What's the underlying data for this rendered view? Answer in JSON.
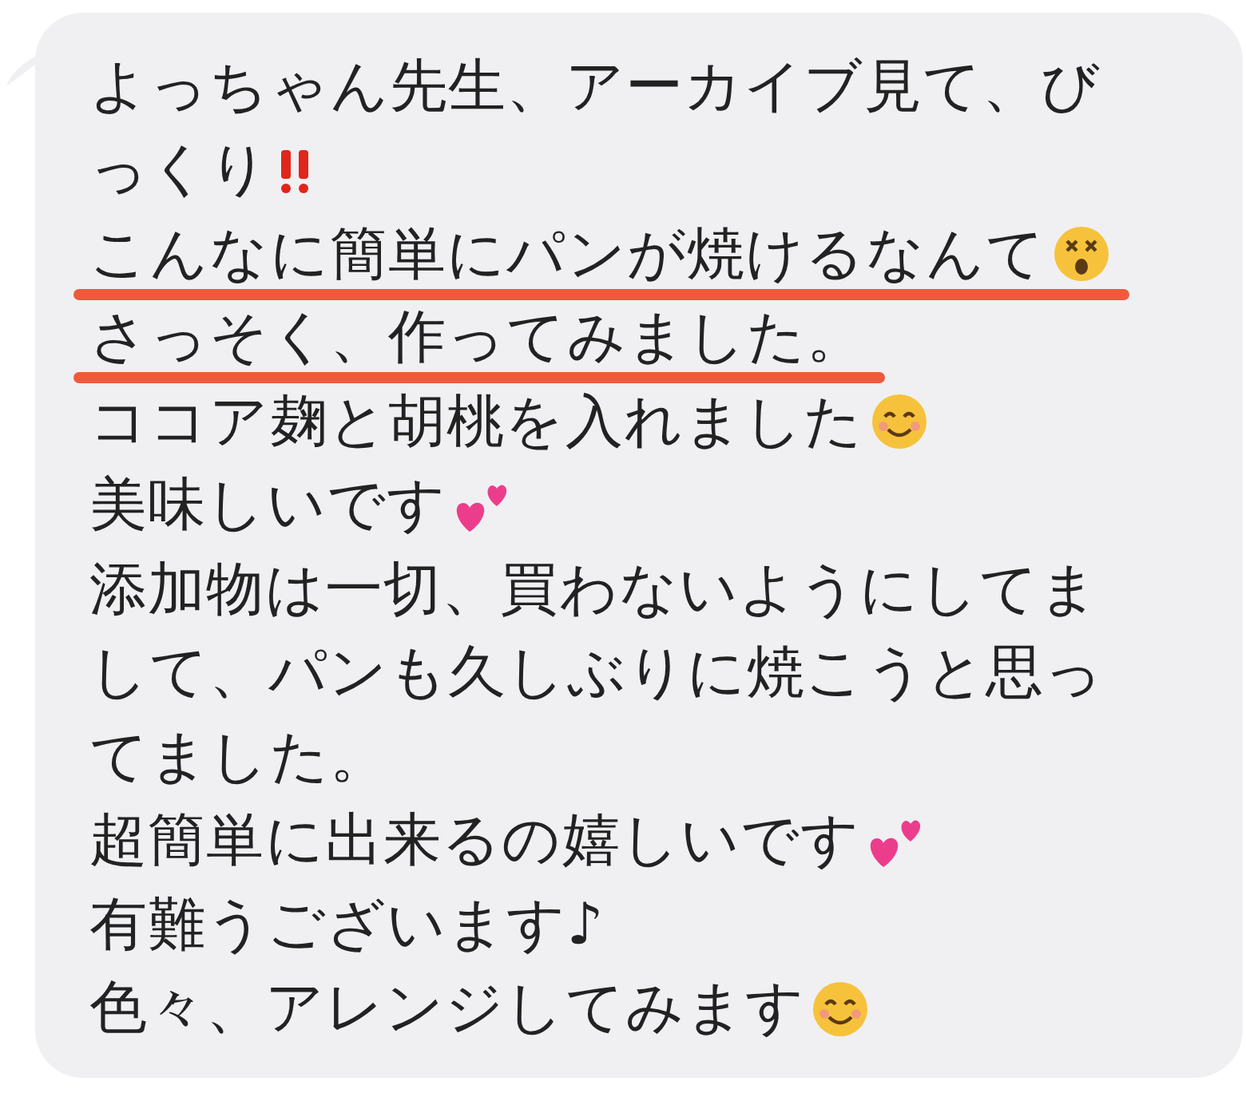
{
  "message": {
    "lines": [
      {
        "text": "よっちゃん先生、アーカイブ見て、び",
        "underlined": false
      },
      {
        "text": "っくり",
        "underlined": false,
        "emoji": {
          "kind": "double-exclamation"
        }
      },
      {
        "text": "こんなに簡単にパンが焼けるなんて",
        "underlined": true,
        "emoji": {
          "kind": "dizzy-face"
        }
      },
      {
        "text": "さっそく、作ってみました。",
        "underlined": true
      },
      {
        "text": "ココア麹と胡桃を入れました",
        "underlined": false,
        "emoji": {
          "kind": "smiling-face"
        }
      },
      {
        "text": "美味しいです",
        "underlined": false,
        "emoji": {
          "kind": "two-hearts"
        }
      },
      {
        "text": "添加物は一切、買わないようにしてま",
        "underlined": false
      },
      {
        "text": "して、パンも久しぶりに焼こうと思っ",
        "underlined": false
      },
      {
        "text": "てました。",
        "underlined": false
      },
      {
        "text": "超簡単に出来るの嬉しいです",
        "underlined": false,
        "emoji": {
          "kind": "two-hearts"
        }
      },
      {
        "text": "有難うございます♪",
        "underlined": false
      },
      {
        "text": "色々、アレンジしてみます",
        "underlined": false,
        "emoji": {
          "kind": "smiling-face"
        }
      }
    ]
  }
}
